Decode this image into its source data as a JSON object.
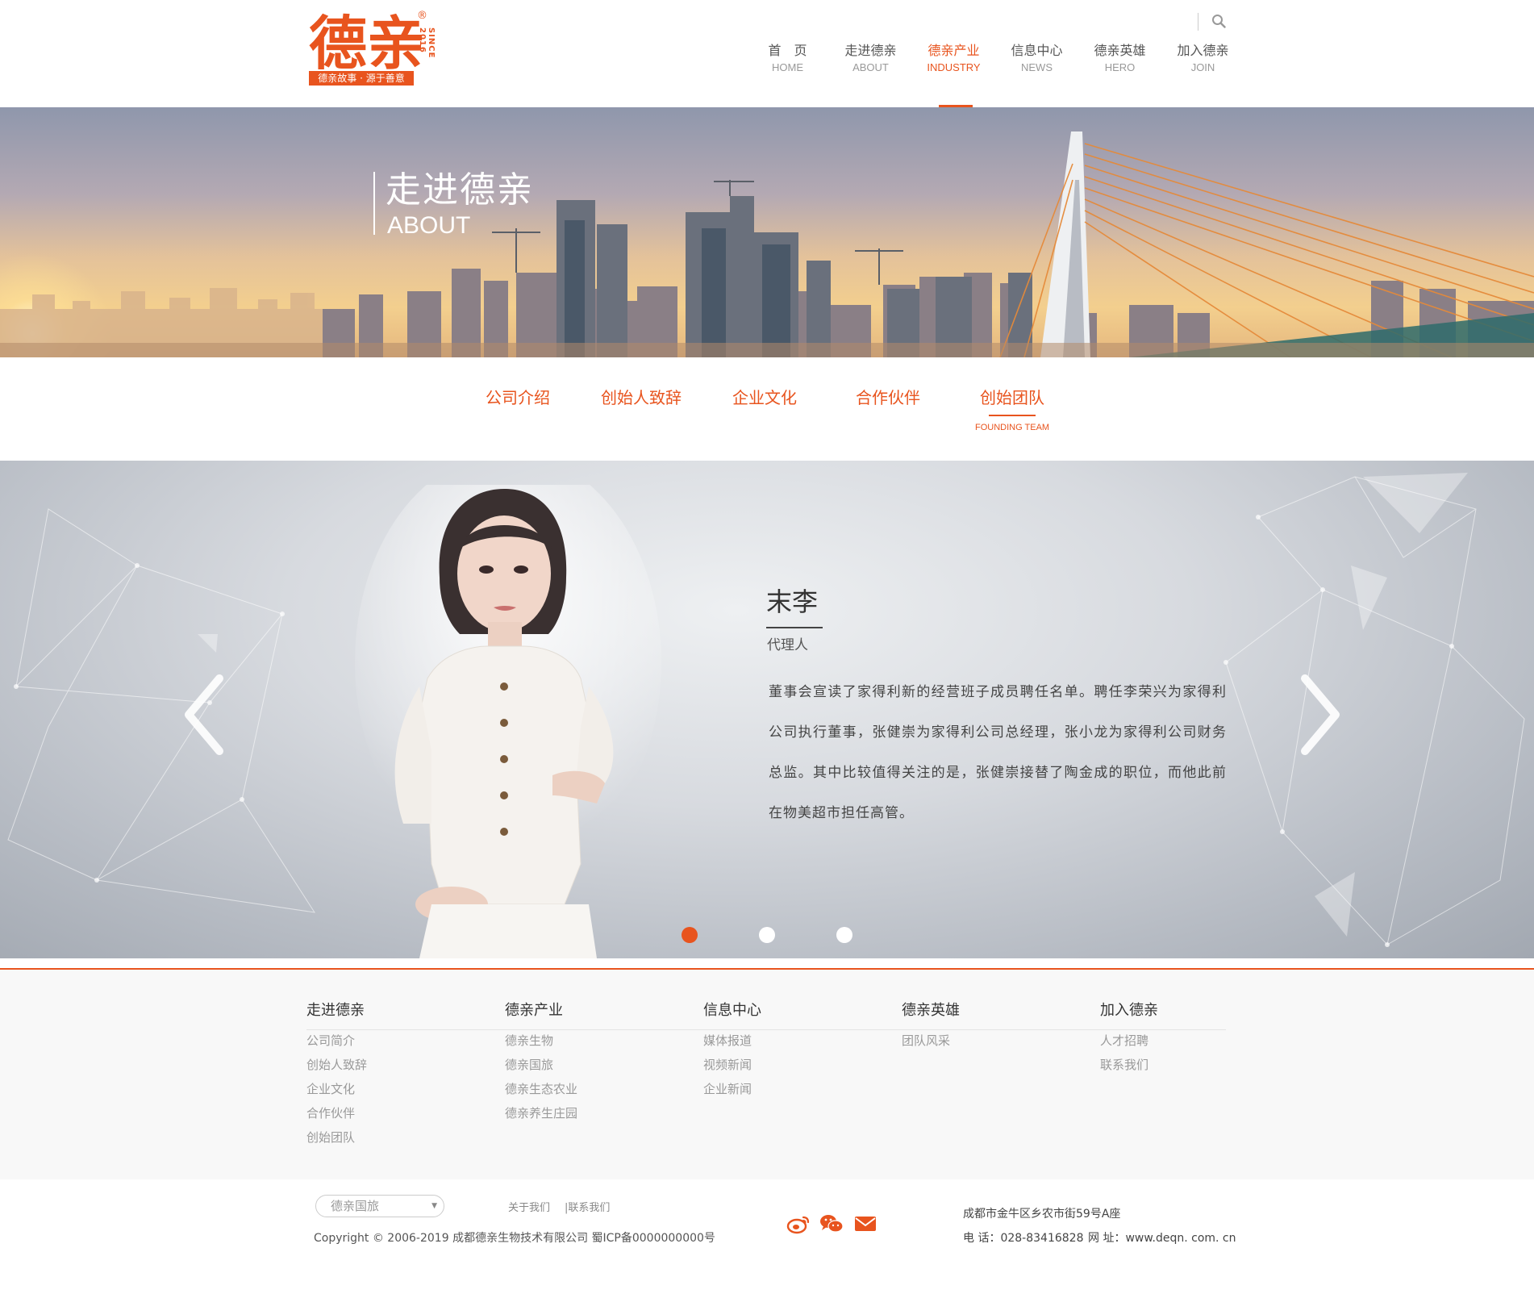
{
  "brand": {
    "logo_text": "德亲",
    "registered": "®",
    "since": "SINCE 2016",
    "slogan": "德亲故事 · 源于善意",
    "accent_color": "#e8541e"
  },
  "nav": {
    "items": [
      {
        "cn": "首　页",
        "en": "HOME"
      },
      {
        "cn": "走进德亲",
        "en": "ABOUT"
      },
      {
        "cn": "德亲产业",
        "en": "INDUSTRY"
      },
      {
        "cn": "信息中心",
        "en": "NEWS"
      },
      {
        "cn": "德亲英雄",
        "en": "HERO"
      },
      {
        "cn": "加入德亲",
        "en": "JOIN"
      }
    ],
    "active_index": 2,
    "search_icon": "search-icon"
  },
  "banner": {
    "title": "走进德亲",
    "subtitle": "ABOUT"
  },
  "subtabs": {
    "items": [
      "公司介绍",
      "创始人致辞",
      "企业文化",
      "合作伙伴",
      "创始团队"
    ],
    "active_index": 4,
    "active_en": "FOUNDING TEAM"
  },
  "team": {
    "name": "末李",
    "role": "代理人",
    "bio": "董事会宣读了家得利新的经营班子成员聘任名单。聘任李荣兴为家得利公司执行董事，张健崇为家得利公司总经理，张小龙为家得利公司财务总监。其中比较值得关注的是，张健崇接替了陶金成的职位，而他此前在物美超市担任高管。",
    "slide_count": 3,
    "active_slide": 0
  },
  "footer": {
    "columns": [
      {
        "title": "走进德亲",
        "items": [
          "公司简介",
          "创始人致辞",
          "企业文化",
          "合作伙伴",
          "创始团队"
        ]
      },
      {
        "title": "德亲产业",
        "items": [
          "德亲生物",
          "德亲国旅",
          "德亲生态农业",
          "德亲养生庄园"
        ]
      },
      {
        "title": "信息中心",
        "items": [
          "媒体报道",
          "视频新闻",
          "企业新闻"
        ]
      },
      {
        "title": "德亲英雄",
        "items": [
          "团队风采"
        ]
      },
      {
        "title": "加入德亲",
        "items": [
          "人才招聘",
          "联系我们"
        ]
      }
    ]
  },
  "bottom": {
    "select_value": "德亲国旅",
    "about_link": "关于我们",
    "contact_link": "|联系我们",
    "copyright": "Copyright © 2006-2019 成都德亲生物技术有限公司  蜀ICP备0000000000号",
    "address": "成都市金牛区乡农市街59号A座",
    "phone": "电  话：028-83416828",
    "website": "网  址：www.deqn. com. cn",
    "social_icons": [
      "weibo-icon",
      "wechat-icon",
      "mail-icon"
    ]
  }
}
